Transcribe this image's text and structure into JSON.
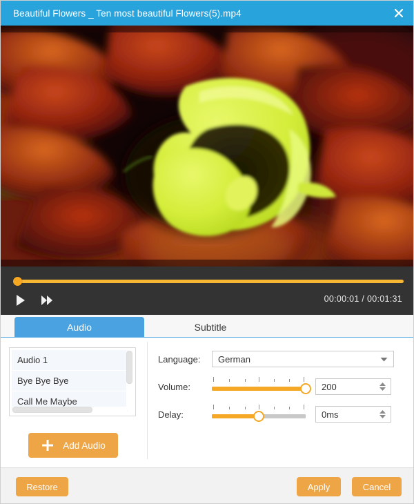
{
  "window": {
    "title": "Beautiful Flowers _ Ten most  beautiful Flowers(5).mp4",
    "close_icon": "close-icon",
    "titlebar_color": "#29a3dc"
  },
  "video": {
    "alt": "Close-up of a chartreuse calla lily surrounded by dark red flower petals",
    "background_color": "#120404"
  },
  "player": {
    "seek_position_percent": 1,
    "play_icon": "play-icon",
    "fast_forward_icon": "fast-forward-icon",
    "current_time": "00:00:01",
    "time_separator": "/",
    "total_time": "00:01:31",
    "time_display": "00:00:01 / 00:01:31",
    "accent_color": "#f5a623",
    "background_color": "#333333"
  },
  "tabs": [
    {
      "label": "Audio",
      "active": true
    },
    {
      "label": "Subtitle",
      "active": false
    }
  ],
  "audio_panel": {
    "list_items": [
      {
        "label": "Audio 1"
      },
      {
        "label": "Bye Bye Bye"
      },
      {
        "label": "Call Me Maybe"
      }
    ],
    "add_audio_label": "Add Audio",
    "add_icon": "plus-icon",
    "button_color": "#eda546"
  },
  "settings": {
    "language": {
      "label": "Language:",
      "value": "German",
      "dropdown_icon": "chevron-down-icon"
    },
    "volume": {
      "label": "Volume:",
      "value": "200",
      "slider_percent": 100,
      "spinner_icon": "spinner-arrows-icon"
    },
    "delay": {
      "label": "Delay:",
      "value": "0ms",
      "slider_percent": 50,
      "spinner_icon": "spinner-arrows-icon"
    }
  },
  "footer": {
    "restore_label": "Restore",
    "apply_label": "Apply",
    "cancel_label": "Cancel"
  }
}
